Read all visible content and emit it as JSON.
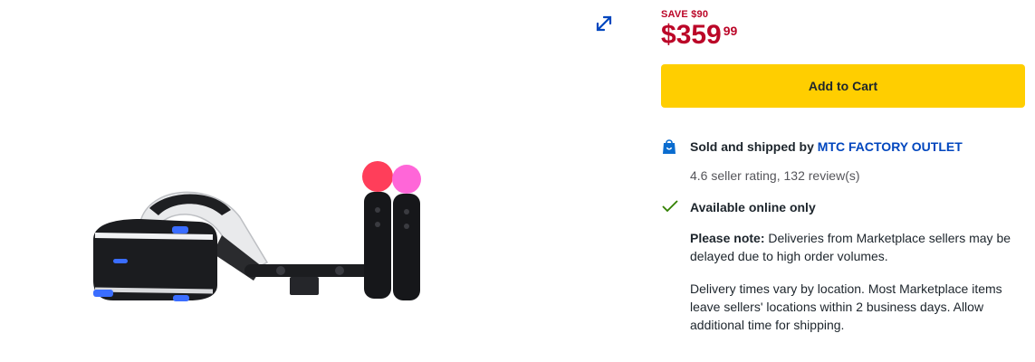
{
  "gallery": {
    "expand_icon": "expand-arrows-icon",
    "image_alt": "PlayStation VR headset with camera and two motion controllers"
  },
  "pricing": {
    "save_text": "SAVE $90",
    "currency": "$",
    "price_main": "359",
    "price_cents": "99"
  },
  "actions": {
    "add_to_cart_label": "Add to Cart"
  },
  "seller": {
    "icon": "shopping-bag-icon",
    "sold_prefix": "Sold and shipped by",
    "name": "MTC FACTORY OUTLET",
    "rating_text": "4.6 seller rating, 132 review(s)"
  },
  "availability": {
    "icon": "checkmark-icon",
    "text": "Available online only"
  },
  "notes": {
    "note_label": "Please note:",
    "note_text": "Deliveries from Marketplace sellers may be delayed due to high order volumes.",
    "delivery_text": "Delivery times vary by location. Most Marketplace items leave sellers' locations within 2 business days. Allow additional time for shipping."
  },
  "colors": {
    "price_red": "#bb0628",
    "cart_yellow": "#ffce00",
    "link_blue": "#0046be",
    "check_green": "#318000"
  }
}
